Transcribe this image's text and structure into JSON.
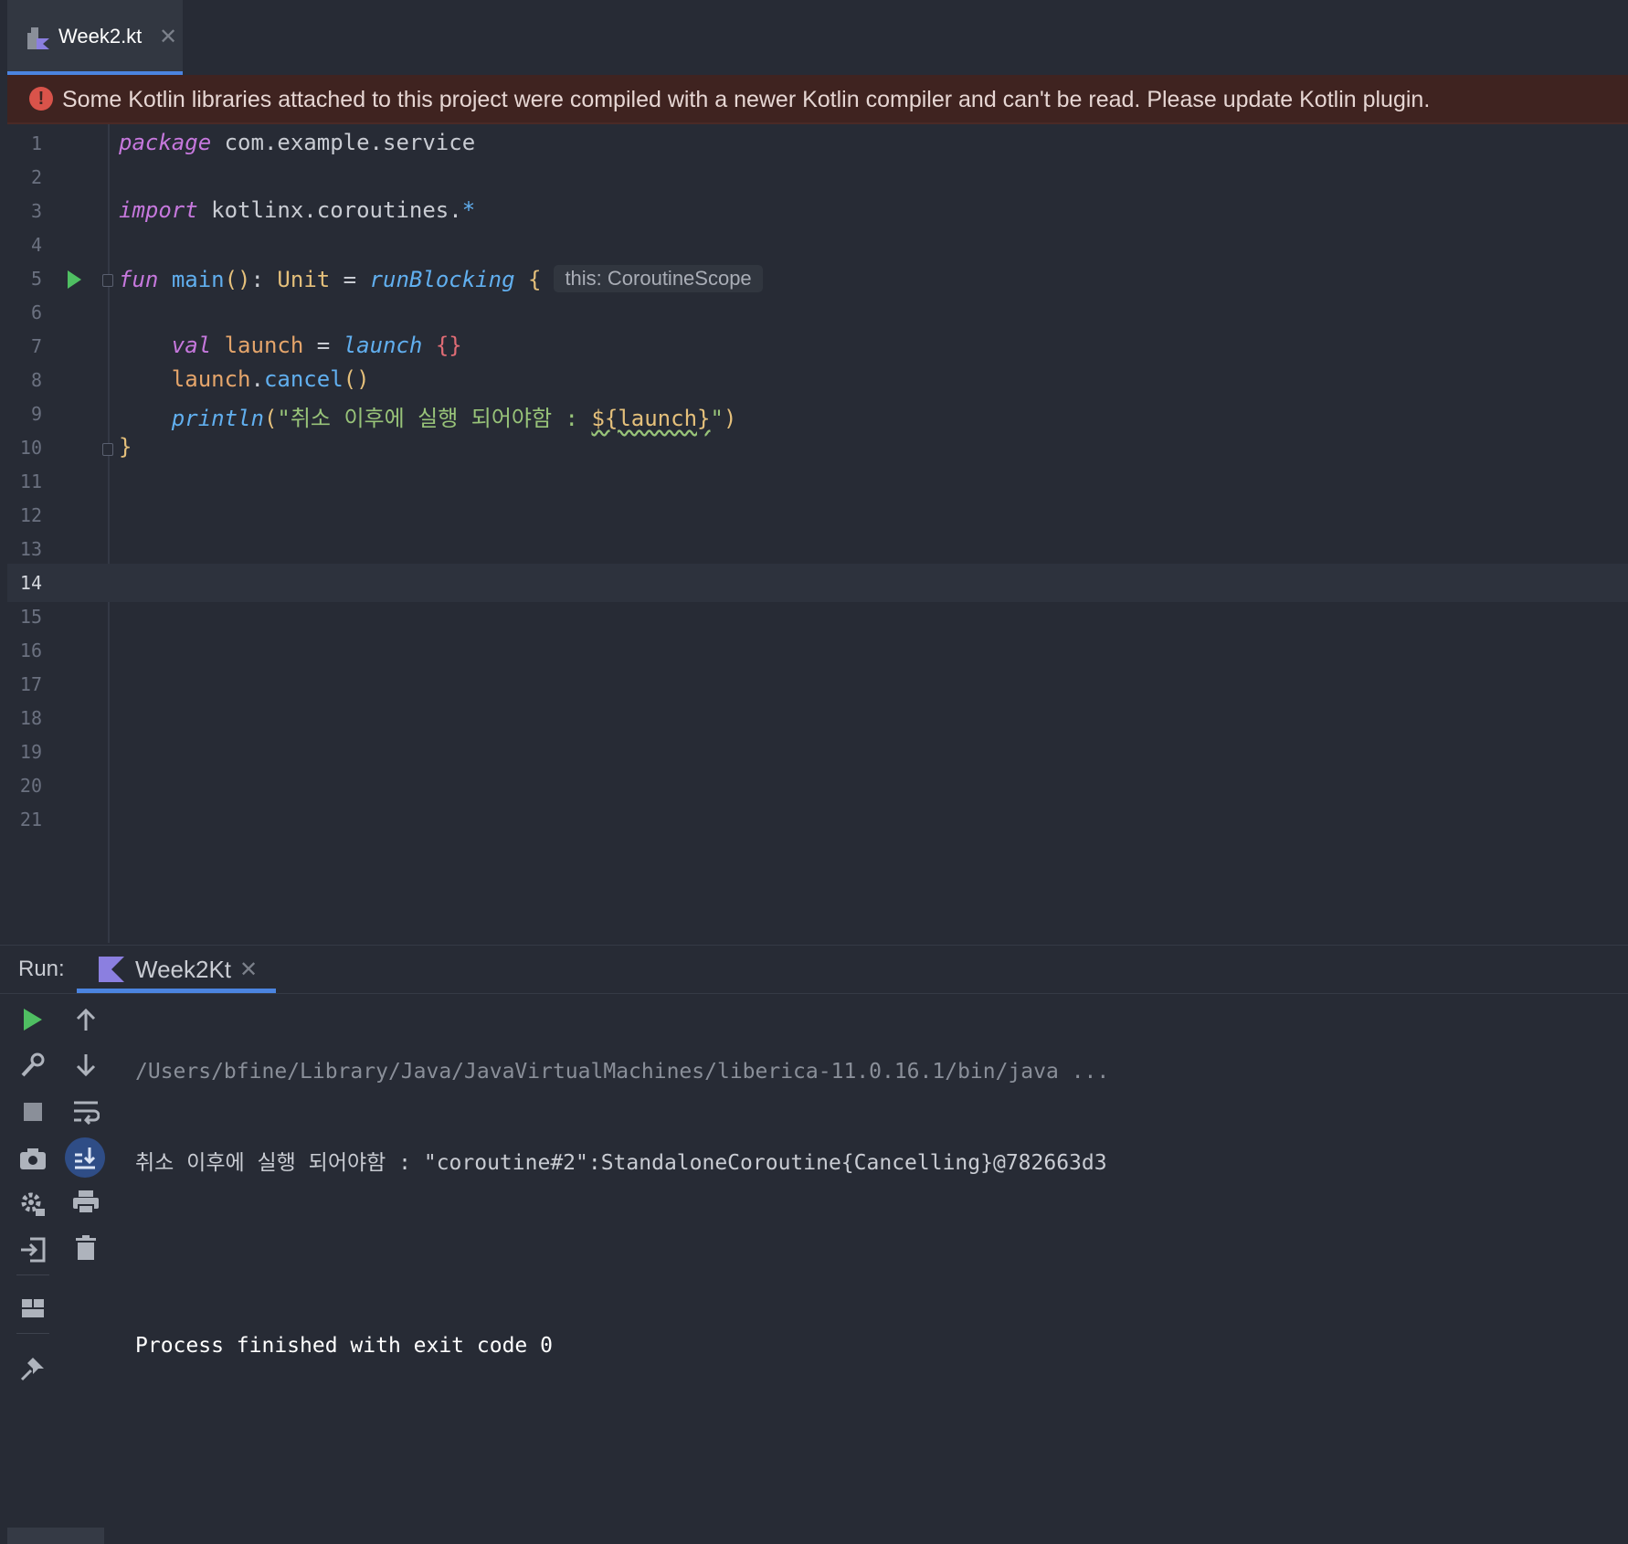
{
  "editor_tab": {
    "filename": "Week2.kt",
    "close": "✕"
  },
  "banner": {
    "message": "Some Kotlin libraries attached to this project were compiled with a newer Kotlin compiler and can't be read. Please update Kotlin plugin.",
    "icon": "error-icon"
  },
  "editor": {
    "line_numbers": [
      "1",
      "2",
      "3",
      "4",
      "5",
      "6",
      "7",
      "8",
      "9",
      "10",
      "11",
      "12",
      "13",
      "14",
      "15",
      "16",
      "17",
      "18",
      "19",
      "20",
      "21"
    ],
    "current_line": 14,
    "code": {
      "l1_kw": "package",
      "l1_rest": " com.example.service",
      "l3_kw": "import",
      "l3_rest": " kotlinx.coroutines.",
      "l3_star": "*",
      "l5_kw": "fun",
      "l5_fn": "main",
      "l5_parens": "()",
      "l5_colon": ": ",
      "l5_type": "Unit",
      "l5_eq": " = ",
      "l5_call": "runBlocking",
      "l5_brace": "{",
      "l5_hint": "this: CoroutineScope",
      "l7_kw": "val",
      "l7_var": "launch",
      "l7_eq": " = ",
      "l7_call": "launch",
      "l7_braces": "{}",
      "l8_var": "launch",
      "l8_dot": ".",
      "l8_fn": "cancel",
      "l8_parens": "()",
      "l9_fn": "println",
      "l9_open": "(",
      "l9_str": "\"취소 이후에 실행 되어야함 : ",
      "l9_tmpl": "${launch}",
      "l9_strend": "\"",
      "l9_close": ")",
      "l10_brace": "}"
    }
  },
  "run_panel": {
    "label": "Run:",
    "tab_name": "Week2Kt",
    "close": "✕",
    "console": [
      "/Users/bfine/Library/Java/JavaVirtualMachines/liberica-11.0.16.1/bin/java ...",
      "취소 이후에 실행 되어야함 : \"coroutine#2\":StandaloneCoroutine{Cancelling}@782663d3",
      "",
      "Process finished with exit code 0"
    ]
  },
  "colors": {
    "background": "#272b35",
    "accent": "#4b84e0",
    "error_banner": "#3f2320",
    "run_green": "#4fbf62"
  }
}
